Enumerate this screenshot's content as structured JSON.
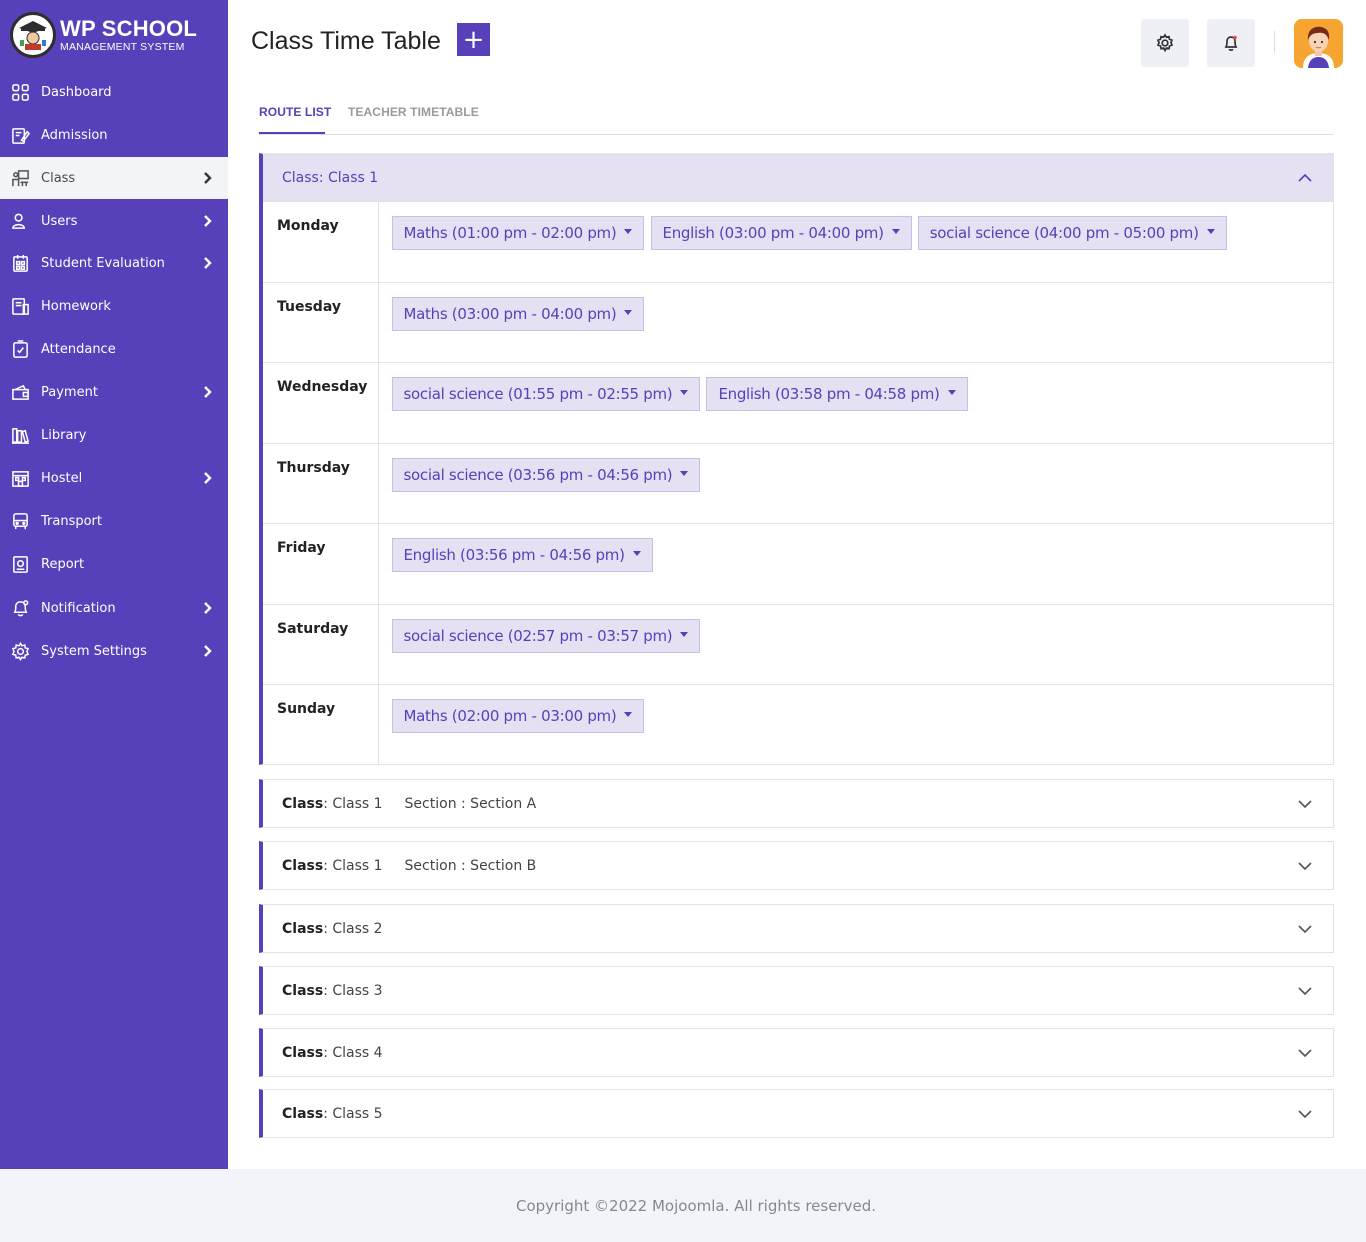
{
  "brand": {
    "title": "WP SCHOOL",
    "subtitle": "MANAGEMENT SYSTEM",
    "accent": "#5840bb"
  },
  "sidebar": {
    "items": [
      {
        "label": "Dashboard",
        "icon": "grid-icon",
        "has_children": false,
        "active": false
      },
      {
        "label": "Admission",
        "icon": "edit-form-icon",
        "has_children": false,
        "active": false
      },
      {
        "label": "Class",
        "icon": "classroom-icon",
        "has_children": true,
        "active": true
      },
      {
        "label": "Users",
        "icon": "user-icon",
        "has_children": true,
        "active": false
      },
      {
        "label": "Student Evaluation",
        "icon": "evaluation-icon",
        "has_children": true,
        "active": false
      },
      {
        "label": "Homework",
        "icon": "homework-icon",
        "has_children": false,
        "active": false
      },
      {
        "label": "Attendance",
        "icon": "attendance-icon",
        "has_children": false,
        "active": false
      },
      {
        "label": "Payment",
        "icon": "wallet-icon",
        "has_children": true,
        "active": false
      },
      {
        "label": "Library",
        "icon": "library-icon",
        "has_children": false,
        "active": false
      },
      {
        "label": "Hostel",
        "icon": "hostel-icon",
        "has_children": true,
        "active": false
      },
      {
        "label": "Transport",
        "icon": "bus-icon",
        "has_children": false,
        "active": false
      },
      {
        "label": "Report",
        "icon": "report-icon",
        "has_children": false,
        "active": false
      },
      {
        "label": "Notification",
        "icon": "notification-icon",
        "has_children": true,
        "active": false
      },
      {
        "label": "System Settings",
        "icon": "settings-icon",
        "has_children": true,
        "active": false
      }
    ]
  },
  "header": {
    "title": "Class Time Table",
    "add_label": "+",
    "settings_icon": "gear-icon",
    "bell_icon": "bell-icon",
    "avatar_icon": "user-avatar"
  },
  "tabs": [
    {
      "label": "ROUTE LIST",
      "active": true
    },
    {
      "label": "TEACHER TIMETABLE",
      "active": false
    }
  ],
  "open_class": {
    "class_key": "Class",
    "class_value": ": Class 1",
    "days": [
      {
        "day": "Monday",
        "slots": [
          "Maths (01:00 pm - 02:00 pm)",
          "English (03:00 pm - 04:00 pm)",
          "social science (04:00 pm - 05:00 pm)"
        ]
      },
      {
        "day": "Tuesday",
        "slots": [
          "Maths (03:00 pm - 04:00 pm)"
        ]
      },
      {
        "day": "Wednesday",
        "slots": [
          "social science (01:55 pm - 02:55 pm)",
          "English (03:58 pm - 04:58 pm)"
        ]
      },
      {
        "day": "Thursday",
        "slots": [
          "social science (03:56 pm - 04:56 pm)"
        ]
      },
      {
        "day": "Friday",
        "slots": [
          "English (03:56 pm - 04:56 pm)"
        ]
      },
      {
        "day": "Saturday",
        "slots": [
          "social science (02:57 pm - 03:57 pm)"
        ]
      },
      {
        "day": "Sunday",
        "slots": [
          "Maths (02:00 pm - 03:00 pm)"
        ]
      }
    ]
  },
  "collapsed_classes": [
    {
      "class_key": "Class",
      "class_value": ": Class 1",
      "section": "Section : Section A"
    },
    {
      "class_key": "Class",
      "class_value": ": Class 1",
      "section": "Section : Section B"
    },
    {
      "class_key": "Class",
      "class_value": ": Class 2",
      "section": ""
    },
    {
      "class_key": "Class",
      "class_value": ": Class 3",
      "section": ""
    },
    {
      "class_key": "Class",
      "class_value": ": Class 4",
      "section": ""
    },
    {
      "class_key": "Class",
      "class_value": ": Class 5",
      "section": ""
    }
  ],
  "footer": {
    "text": "Copyright ©2022 Mojoomla. All rights reserved."
  }
}
